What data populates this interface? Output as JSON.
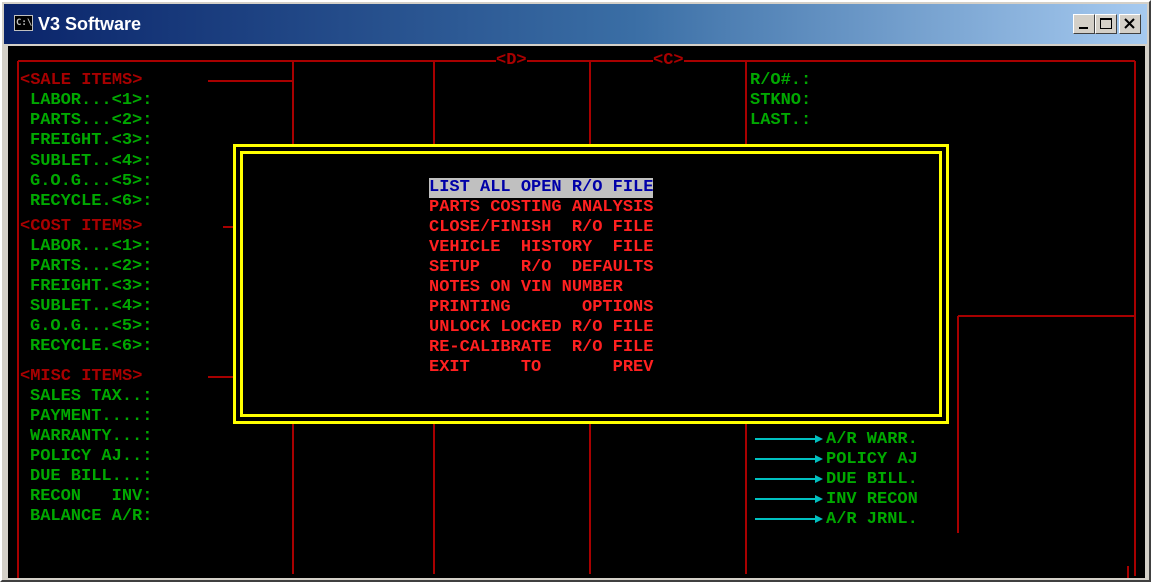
{
  "window": {
    "title": "V3 Software",
    "icon_text": "C:\\"
  },
  "header": {
    "col_d": "<D>",
    "col_c": "<C>"
  },
  "sale_items": {
    "header": "<SALE ITEMS>",
    "rows": [
      "LABOR...<1>:",
      "PARTS...<2>:",
      "FREIGHT.<3>:",
      "SUBLET..<4>:",
      "G.O.G...<5>:",
      "RECYCLE.<6>:"
    ]
  },
  "cost_items": {
    "header": "<COST ITEMS>",
    "rows": [
      "LABOR...<1>:",
      "PARTS...<2>:",
      "FREIGHT.<3>:",
      "SUBLET..<4>:",
      "G.O.G...<5>:",
      "RECYCLE.<6>:"
    ]
  },
  "misc_items": {
    "header": "<MISC ITEMS>",
    "rows": [
      "SALES TAX..:",
      "PAYMENT....:",
      "WARRANTY...:",
      "POLICY AJ..:",
      "DUE BILL...:",
      "RECON   INV:",
      "BALANCE A/R:"
    ]
  },
  "info": [
    "R/O#.:",
    "STKNO:",
    "LAST.:"
  ],
  "journals": [
    "A/R WARR.",
    "POLICY AJ",
    "DUE BILL.",
    "INV RECON",
    "A/R JRNL."
  ],
  "menu": {
    "items": [
      "LIST ALL OPEN R/O FILE",
      "PARTS COSTING ANALYSIS",
      "CLOSE/FINISH  R/O FILE",
      "VEHICLE  HISTORY  FILE",
      "SETUP    R/O  DEFAULTS",
      "NOTES ON VIN NUMBER",
      "PRINTING       OPTIONS",
      "UNLOCK LOCKED R/O FILE",
      "RE-CALIBRATE  R/O FILE",
      "EXIT     TO       PREV"
    ],
    "selected_index": 0
  },
  "colors": {
    "green": "#00a800",
    "dark_red": "#a80000",
    "bright_red": "#ff2020",
    "yellow": "#ffff00",
    "cyan": "#00c0c0",
    "highlight_bg": "#c0c0c0",
    "highlight_fg": "#0000a8"
  }
}
